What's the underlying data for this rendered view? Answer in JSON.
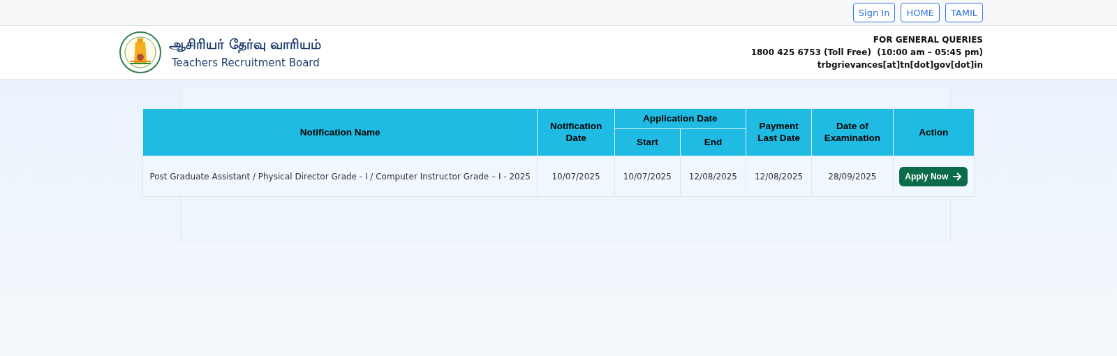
{
  "top_nav": {
    "buttons": [
      "Sign In",
      "HOME",
      "TAMIL"
    ]
  },
  "header": {
    "title_tamil": "ஆசிரியர் தேர்வு வாரியம்",
    "title_english": "Teachers Recruitment Board",
    "contact": [
      "FOR GENERAL QUERIES",
      "1800 425 6753 (Toll Free)  (10:00 am – 05:45 pm)",
      "trbgrievances[at]tn[dot]gov[dot]in"
    ]
  },
  "table": {
    "columns": {
      "name": "Notification Name",
      "notification_date": "Notification Date",
      "application_date": "Application Date",
      "start": "Start",
      "end": "End",
      "payment": "Payment Last Date",
      "exam": "Date of Examination",
      "action": "Action"
    },
    "rows": [
      {
        "name": "Post Graduate Assistant / Physical Director Grade - I / Computer Instructor Grade – I - 2025",
        "notification_date": "10/07/2025",
        "start": "10/07/2025",
        "end": "12/08/2025",
        "payment": "12/08/2025",
        "exam": "28/09/2025",
        "action": "Apply Now"
      }
    ]
  }
}
